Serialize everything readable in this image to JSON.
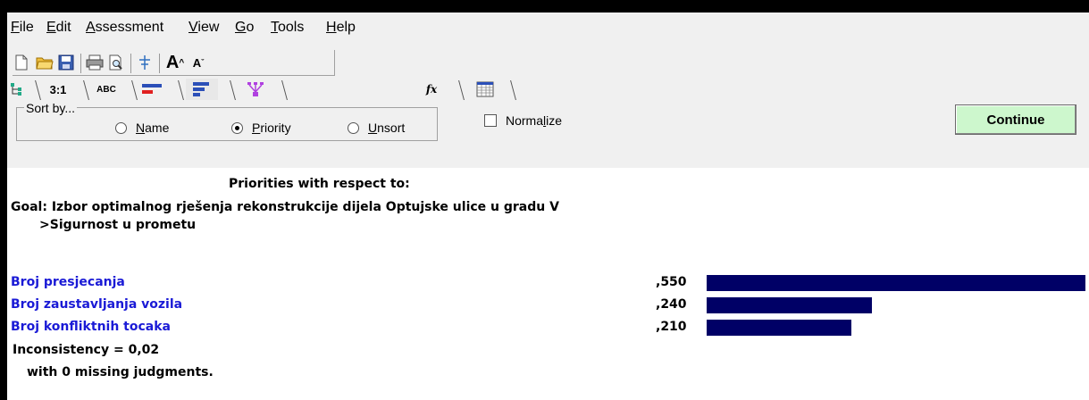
{
  "menu": {
    "items": [
      {
        "pre": "",
        "ul": "F",
        "post": "ile"
      },
      {
        "pre": "",
        "ul": "E",
        "post": "dit"
      },
      {
        "pre": "",
        "ul": "A",
        "post": "ssessment"
      },
      {
        "pre": "",
        "ul": "V",
        "post": "iew"
      },
      {
        "pre": "",
        "ul": "G",
        "post": "o"
      },
      {
        "pre": "",
        "ul": "T",
        "post": "ools"
      },
      {
        "pre": "",
        "ul": "H",
        "post": "elp"
      }
    ]
  },
  "tabs": {
    "ratio": "3:1",
    "abc": "ABC",
    "fx": "fx"
  },
  "sort": {
    "legend": "Sort by...",
    "name": {
      "ul": "N",
      "post": "ame"
    },
    "priority": {
      "ul": "P",
      "post": "riority"
    },
    "unsort": {
      "ul": "U",
      "post": "nsort"
    },
    "selected": "priority"
  },
  "normalize": {
    "pre": "Norma",
    "ul": "l",
    "post": "ize",
    "checked": false
  },
  "continue_label": "Continue",
  "content": {
    "heading": "Priorities with respect to:",
    "goal": "Goal: Izbor optimalnog rješenja rekonstrukcije dijela Optujske ulice u gradu V",
    "subgoal": ">Sigurnost u prometu",
    "items": [
      {
        "label": "Broj presjecanja",
        "value_text": ",550",
        "value": 0.55
      },
      {
        "label": "Broj zaustavljanja vozila",
        "value_text": ",240",
        "value": 0.24
      },
      {
        "label": "Broj konfliktnih tocaka",
        "value_text": ",210",
        "value": 0.21
      }
    ],
    "inconsistency": "Inconsistency = 0,02",
    "missing": "with 0  missing judgments."
  }
}
